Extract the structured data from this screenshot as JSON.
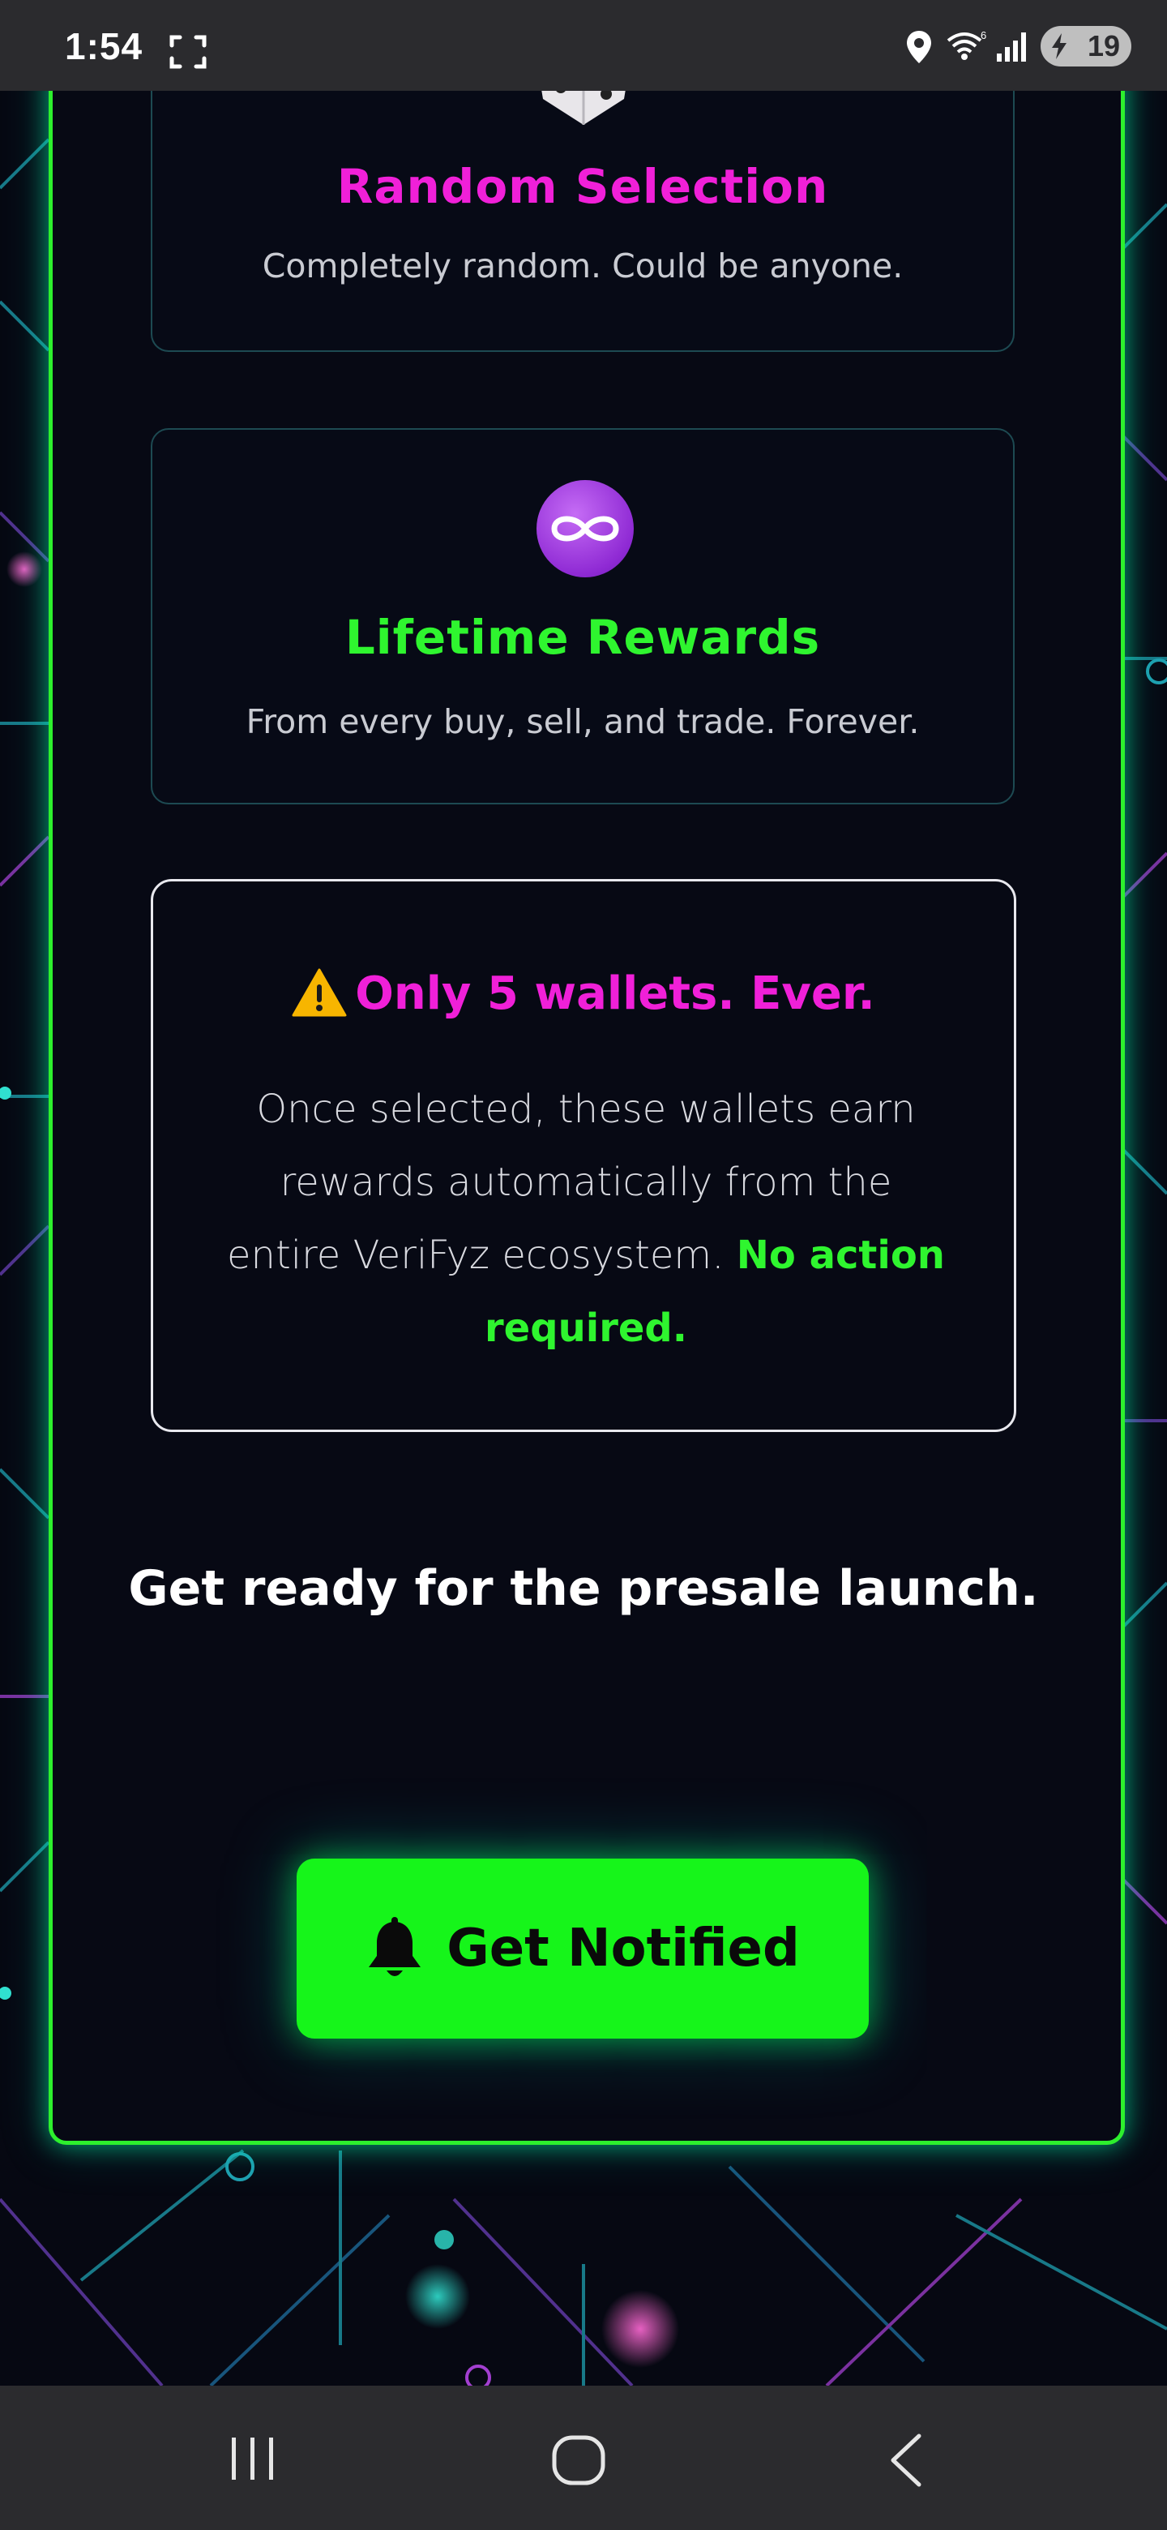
{
  "status_bar": {
    "time": "1:54",
    "battery_level": "19",
    "icons": [
      "screenshot-icon",
      "location-icon",
      "wifi-icon",
      "signal-icon",
      "battery-charging-icon"
    ]
  },
  "features": {
    "random": {
      "icon": "dice-icon",
      "title": "Random Selection",
      "description": "Completely random. Could be anyone."
    },
    "lifetime": {
      "icon": "infinity-icon",
      "title": "Lifetime Rewards",
      "description": "From every buy, sell, and trade. Forever."
    }
  },
  "warning": {
    "icon": "warning-icon",
    "title": "Only 5 wallets. Ever.",
    "body": "Once selected, these wallets earn rewards automatically from the entire VeriFyz ecosystem.",
    "accent": "No action required."
  },
  "presale_text": "Get ready for the presale launch.",
  "cta": {
    "icon": "bell-icon",
    "label": "Get Notified"
  },
  "nav_bar": {
    "items": [
      "recents-icon",
      "home-icon",
      "back-icon"
    ]
  },
  "colors": {
    "accent_green": "#2ff52f",
    "accent_magenta": "#f020d8",
    "background": "#070914",
    "button_green": "#16f51a"
  }
}
